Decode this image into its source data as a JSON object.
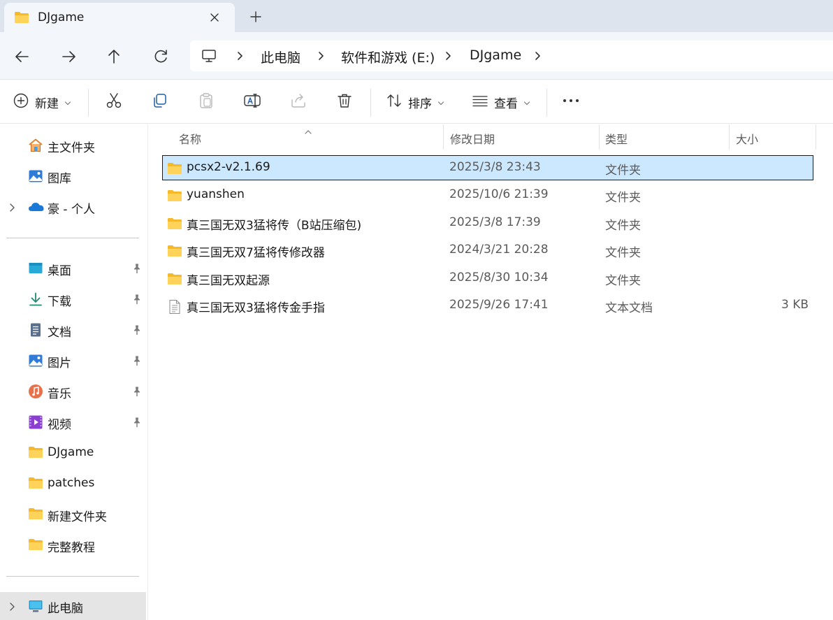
{
  "tab": {
    "title": "DJgame"
  },
  "address": {
    "crumbs": [
      "此电脑",
      "软件和游戏 (E:)",
      "DJgame"
    ]
  },
  "toolbar": {
    "new_label": "新建",
    "sort_label": "排序",
    "view_label": "查看"
  },
  "sidebar": {
    "top": [
      {
        "label": "主文件夹",
        "icon": "home-icon"
      },
      {
        "label": "图库",
        "icon": "gallery-icon"
      },
      {
        "label": "豪 - 个人",
        "icon": "onedrive-icon"
      }
    ],
    "quick": [
      {
        "label": "桌面",
        "icon": "desktop-icon"
      },
      {
        "label": "下载",
        "icon": "download-icon"
      },
      {
        "label": "文档",
        "icon": "document-icon"
      },
      {
        "label": "图片",
        "icon": "pictures-icon"
      },
      {
        "label": "音乐",
        "icon": "music-icon"
      },
      {
        "label": "视频",
        "icon": "video-icon"
      },
      {
        "label": "DJgame",
        "icon": "folder-icon"
      },
      {
        "label": "patches",
        "icon": "folder-icon"
      },
      {
        "label": "新建文件夹",
        "icon": "folder-icon"
      },
      {
        "label": "完整教程",
        "icon": "folder-icon"
      }
    ],
    "this_pc": "此电脑"
  },
  "columns": {
    "name": "名称",
    "modified": "修改日期",
    "type": "类型",
    "size": "大小"
  },
  "files": [
    {
      "name": "pcsx2-v2.1.69",
      "modified": "2025/3/8 23:43",
      "type": "文件夹",
      "size": "",
      "kind": "folder",
      "selected": true
    },
    {
      "name": "yuanshen",
      "modified": "2025/10/6 21:39",
      "type": "文件夹",
      "size": "",
      "kind": "folder"
    },
    {
      "name": "真三国无双3猛将传（B站压缩包)",
      "modified": "2025/3/8 17:39",
      "type": "文件夹",
      "size": "",
      "kind": "folder"
    },
    {
      "name": "真三国无双7猛将传修改器",
      "modified": "2024/3/21 20:28",
      "type": "文件夹",
      "size": "",
      "kind": "folder"
    },
    {
      "name": "真三国无双起源",
      "modified": "2025/8/30 10:34",
      "type": "文件夹",
      "size": "",
      "kind": "folder"
    },
    {
      "name": "真三国无双3猛将传金手指",
      "modified": "2025/9/26 17:41",
      "type": "文本文档",
      "size": "3 KB",
      "kind": "text"
    }
  ],
  "colors": {
    "accent": "#0067c0",
    "folder": "#f8c940",
    "selection": "#cce8ff",
    "chrome": "#f3f6fb",
    "tabstrip": "#dde4ee"
  }
}
